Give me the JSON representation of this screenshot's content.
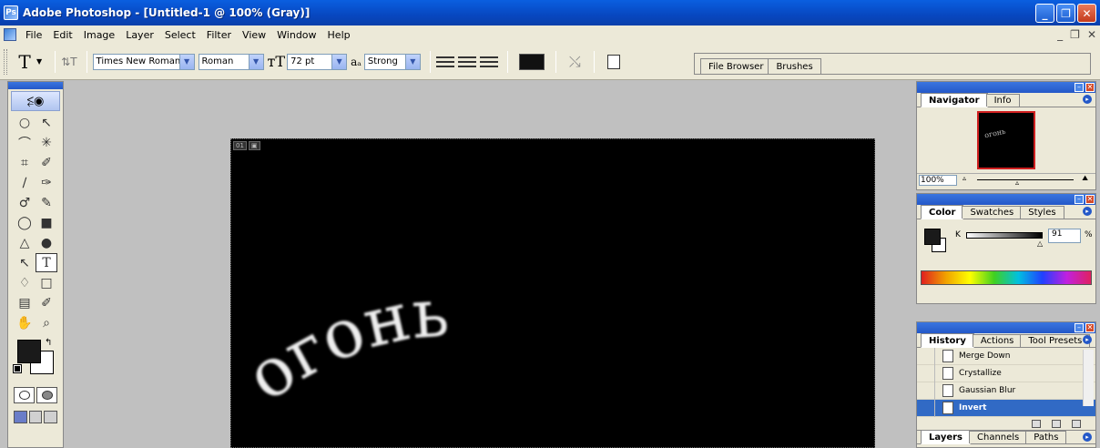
{
  "window": {
    "title": "Adobe Photoshop - [Untitled-1 @ 100% (Gray)]",
    "icon": "photoshop-icon",
    "buttons": [
      "minimize",
      "restore",
      "close"
    ]
  },
  "menu": {
    "items": [
      "File",
      "Edit",
      "Image",
      "Layer",
      "Select",
      "Filter",
      "View",
      "Window",
      "Help"
    ],
    "mdi_controls": [
      "_",
      "❐",
      "✕"
    ]
  },
  "options": {
    "tool_label": "T",
    "font_family": "Times New Roman ...",
    "font_style": "Roman",
    "font_size": "72 pt",
    "antialias": "Strong",
    "swatch_color": "#111111",
    "well_tabs": [
      "File Browser",
      "Brushes"
    ]
  },
  "toolbox": {
    "tools": [
      [
        "○",
        "↖"
      ],
      [
        "⌒",
        "✳"
      ],
      [
        "⌗",
        "✐"
      ],
      [
        "∕",
        "✑"
      ],
      [
        "♂",
        "✎"
      ],
      [
        "◯",
        "■"
      ],
      [
        "△",
        "●"
      ],
      [
        "↖",
        "T"
      ],
      [
        "♢",
        "□"
      ],
      [
        "▤",
        "✐"
      ],
      [
        "✋",
        "⌕"
      ]
    ],
    "active_tool": "T",
    "foreground_color": "#1a1a1a",
    "background_color": "#ffffff"
  },
  "document": {
    "corner_labels": [
      "01",
      "▣"
    ],
    "text": "огонь",
    "canvas_color": "#000000"
  },
  "navigator": {
    "tabs": [
      "Navigator",
      "Info"
    ],
    "thumb_text": "огонь",
    "zoom": "100%"
  },
  "color": {
    "tabs": [
      "Color",
      "Swatches",
      "Styles"
    ],
    "channel": "K",
    "value": "91",
    "unit": "%"
  },
  "history": {
    "tabs": [
      "History",
      "Actions",
      "Tool Presets"
    ],
    "items": [
      "Merge Down",
      "Crystallize",
      "Gaussian Blur",
      "Invert"
    ],
    "active_index": 3
  },
  "layers": {
    "tabs": [
      "Layers",
      "Channels",
      "Paths"
    ]
  }
}
